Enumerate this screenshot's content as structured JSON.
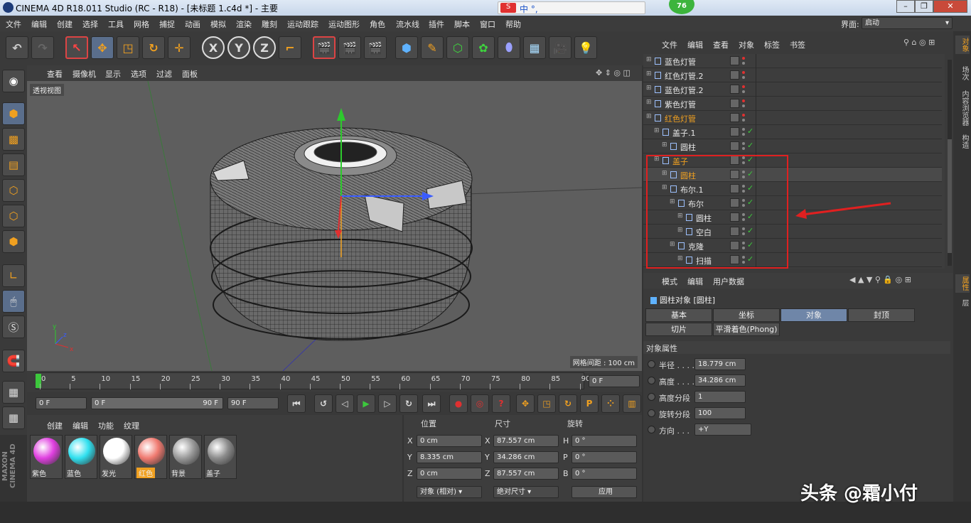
{
  "window": {
    "title": "CINEMA 4D R18.011 Studio (RC - R18) - [未标题 1.c4d *] - 主要",
    "ime": "中 °,",
    "score": "76"
  },
  "menu": [
    "文件",
    "编辑",
    "创建",
    "选择",
    "工具",
    "网格",
    "捕捉",
    "动画",
    "模拟",
    "渲染",
    "雕刻",
    "运动跟踪",
    "运动图形",
    "角色",
    "流水线",
    "插件",
    "脚本",
    "窗口",
    "帮助"
  ],
  "layout_label": "界面:",
  "layout_value": "启动",
  "toolbar": {
    "axis_x": "X",
    "axis_y": "Y",
    "axis_z": "Z"
  },
  "viewport": {
    "menu": [
      "查看",
      "摄像机",
      "显示",
      "选项",
      "过滤",
      "面板"
    ],
    "label": "透视视图",
    "grid_spacing": "网格间距 : 100 cm"
  },
  "timeline": {
    "ticks": [
      "0",
      "5",
      "10",
      "15",
      "20",
      "25",
      "30",
      "35",
      "40",
      "45",
      "50",
      "55",
      "60",
      "65",
      "70",
      "75",
      "80",
      "85",
      "90"
    ],
    "frame_field": "0 F"
  },
  "transport": {
    "start": "0 F",
    "range_start": "0 F",
    "range_end": "90 F",
    "end": "90 F"
  },
  "materials": {
    "menu": [
      "创建",
      "编辑",
      "功能",
      "纹理"
    ],
    "items": [
      {
        "name": "紫色",
        "color": "#e040e0"
      },
      {
        "name": "蓝色",
        "color": "#30e0ef"
      },
      {
        "name": "发光",
        "color": "#ffffff"
      },
      {
        "name": "红色",
        "color": "#f07a70"
      },
      {
        "name": "背景",
        "color": "#9a9a9a"
      },
      {
        "name": "盖子",
        "color": "#8c8c8c"
      }
    ]
  },
  "coords": {
    "headers": [
      "位置",
      "尺寸",
      "旋转"
    ],
    "rows": [
      {
        "a": "X",
        "pos": "0 cm",
        "b": "X",
        "size": "87.557 cm",
        "c": "H",
        "rot": "0 °"
      },
      {
        "a": "Y",
        "pos": "8.335 cm",
        "b": "Y",
        "size": "34.286 cm",
        "c": "P",
        "rot": "0 °"
      },
      {
        "a": "Z",
        "pos": "0 cm",
        "b": "Z",
        "size": "87.557 cm",
        "c": "B",
        "rot": "0 °"
      }
    ],
    "mode1": "对象 (相对)",
    "mode2": "绝对尺寸",
    "apply": "应用"
  },
  "objects": {
    "menu": [
      "文件",
      "编辑",
      "查看",
      "对象",
      "标签",
      "书签"
    ],
    "rows": [
      {
        "name": "蓝色灯管",
        "indent": 0,
        "selected": false
      },
      {
        "name": "红色灯管.2",
        "indent": 0,
        "selected": false
      },
      {
        "name": "蓝色灯管.2",
        "indent": 0,
        "selected": false
      },
      {
        "name": "紫色灯管",
        "indent": 0,
        "selected": false
      },
      {
        "name": "红色灯管",
        "indent": 0,
        "selected": false,
        "orange": true
      },
      {
        "name": "盖子.1",
        "indent": 1,
        "selected": false
      },
      {
        "name": "圆柱",
        "indent": 2,
        "selected": false
      },
      {
        "name": "盖子",
        "indent": 1,
        "selected": false,
        "orange": true
      },
      {
        "name": "圆柱",
        "indent": 2,
        "selected": true,
        "orange": true
      },
      {
        "name": "布尔.1",
        "indent": 2,
        "selected": false
      },
      {
        "name": "布尔",
        "indent": 3,
        "selected": false
      },
      {
        "name": "圆柱",
        "indent": 4,
        "selected": false
      },
      {
        "name": "空白",
        "indent": 4,
        "selected": false
      },
      {
        "name": "克隆",
        "indent": 3,
        "selected": false
      },
      {
        "name": "扫描",
        "indent": 4,
        "selected": false
      }
    ]
  },
  "attributes": {
    "menu": [
      "模式",
      "编辑",
      "用户数据"
    ],
    "title": "圆柱对象 [圆柱]",
    "tabs": [
      "基本",
      "坐标",
      "对象",
      "封顶",
      "切片",
      "平滑着色(Phong)"
    ],
    "section": "对象属性",
    "fields": [
      {
        "label": "半径 . . . .",
        "value": "18.779 cm"
      },
      {
        "label": "高度 . . . .",
        "value": "34.286 cm"
      },
      {
        "label": "高度分段",
        "value": "1"
      },
      {
        "label": "旋转分段",
        "value": "100"
      },
      {
        "label": "方向 . . .",
        "value": "+Y"
      }
    ]
  },
  "side_tabs": [
    "对象",
    "场次",
    "内容浏览器",
    "构造"
  ],
  "side_tabs2": [
    "属性",
    "层"
  ],
  "brand": "MAXON CINEMA 4D",
  "watermark": "头条 @霜小付"
}
